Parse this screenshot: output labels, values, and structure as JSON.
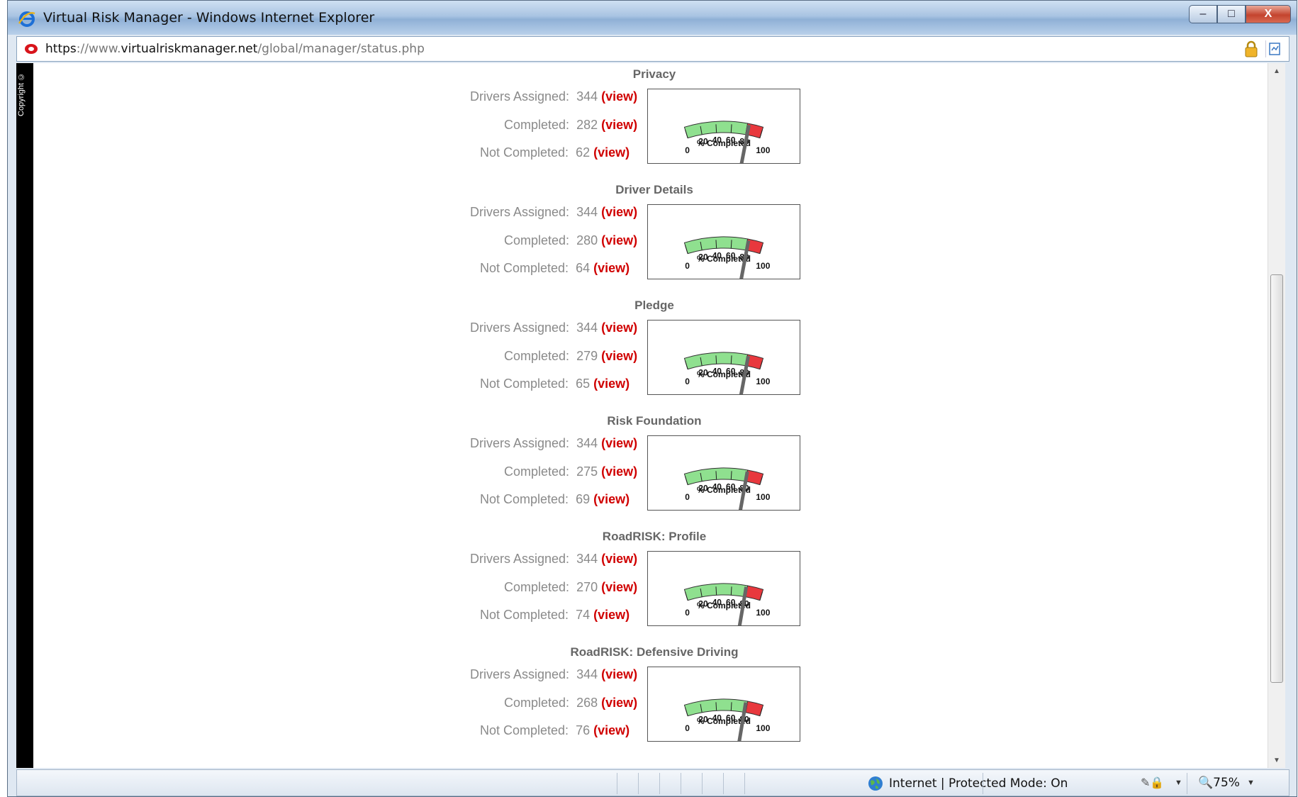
{
  "window": {
    "title": "Virtual Risk Manager - Windows Internet Explorer",
    "buttons": {
      "minimize": "–",
      "maximize": "□",
      "close": "X"
    }
  },
  "address": {
    "scheme": "https",
    "separator": "://",
    "subdomain": "www.",
    "domain": "virtualriskmanager.net",
    "path": "/global/manager/status.php"
  },
  "sidebar": {
    "copyright": "Copyright ©"
  },
  "labels": {
    "assigned": "Drivers Assigned:",
    "completed": "Completed:",
    "not_completed": "Not Completed:",
    "view": "(view)"
  },
  "gauge": {
    "ticks": [
      "0",
      "20",
      "40",
      "60",
      "80",
      "100"
    ],
    "caption": "% Completed",
    "colors": {
      "green": "#8fe08f",
      "red": "#e8383d",
      "needle": "#666666"
    }
  },
  "sections": [
    {
      "title": "Privacy",
      "assigned": "344",
      "completed": "282",
      "not_completed": "62",
      "percent": 81.98
    },
    {
      "title": "Driver Details",
      "assigned": "344",
      "completed": "280",
      "not_completed": "64",
      "percent": 81.4
    },
    {
      "title": "Pledge",
      "assigned": "344",
      "completed": "279",
      "not_completed": "65",
      "percent": 81.1
    },
    {
      "title": "Risk Foundation",
      "assigned": "344",
      "completed": "275",
      "not_completed": "69",
      "percent": 79.94
    },
    {
      "title": "RoadRISK: Profile",
      "assigned": "344",
      "completed": "270",
      "not_completed": "74",
      "percent": 78.49
    },
    {
      "title": "RoadRISK: Defensive Driving",
      "assigned": "344",
      "completed": "268",
      "not_completed": "76",
      "percent": 77.91
    }
  ],
  "statusbar": {
    "zone": "Internet | Protected Mode: On",
    "zoom": "75%"
  }
}
